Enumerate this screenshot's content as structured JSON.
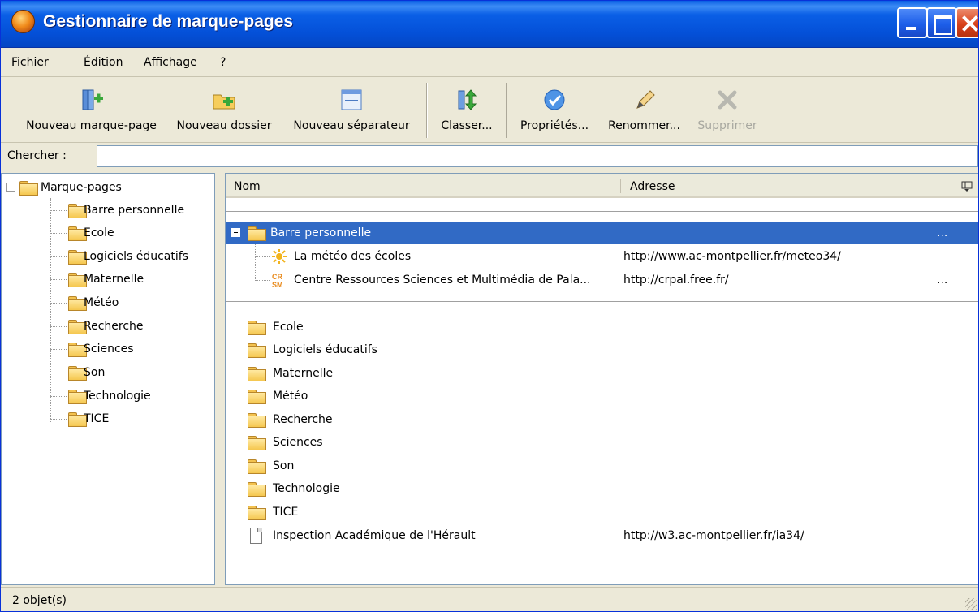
{
  "window": {
    "title": "Gestionnaire de marque-pages"
  },
  "menu": {
    "items": [
      {
        "label": "Fichier"
      },
      {
        "label": "Édition"
      },
      {
        "label": "Affichage"
      },
      {
        "label": "?"
      }
    ]
  },
  "toolbar": {
    "new_bookmark": "Nouveau marque-page",
    "new_folder": "Nouveau dossier",
    "new_separator": "Nouveau séparateur",
    "sort": "Classer...",
    "properties": "Propriétés...",
    "rename": "Renommer...",
    "delete": "Supprimer"
  },
  "search": {
    "label": "Chercher :",
    "value": ""
  },
  "tree": {
    "root": "Marque-pages",
    "folders": [
      "Barre personnelle",
      "Ecole",
      "Logiciels éducatifs",
      "Maternelle",
      "Météo",
      "Recherche",
      "Sciences",
      "Son",
      "Technologie",
      "TICE"
    ]
  },
  "list": {
    "columns": {
      "name": "Nom",
      "address": "Adresse"
    },
    "expanded_folder": {
      "name": "Barre personnelle",
      "ellipsis": "..."
    },
    "children": [
      {
        "name": "La météo des écoles",
        "address": "http://www.ac-montpellier.fr/meteo34/",
        "ellipsis": ""
      },
      {
        "name": "Centre Ressources Sciences et Multimédia de Pala...",
        "address": "http://crpal.free.fr/",
        "ellipsis": "..."
      }
    ],
    "folders": [
      "Ecole",
      "Logiciels éducatifs",
      "Maternelle",
      "Météo",
      "Recherche",
      "Sciences",
      "Son",
      "Technologie",
      "TICE"
    ],
    "bookmark": {
      "name": "Inspection Académique de l'Hérault",
      "address": "http://w3.ac-montpellier.fr/ia34/"
    }
  },
  "status": {
    "text": "2 objet(s)"
  },
  "colors": {
    "title_bar": "#0450d8",
    "selection": "#316ac5",
    "window_bg": "#ece9d8"
  }
}
